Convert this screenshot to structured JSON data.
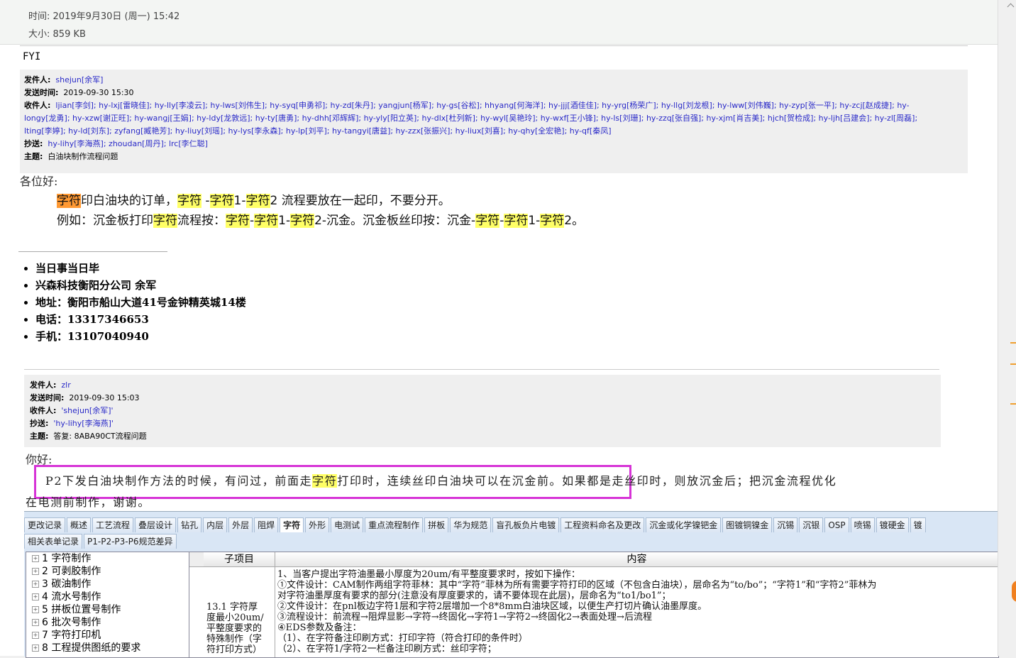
{
  "header": {
    "time_label": "时间:",
    "time_value": "2019年9月30日 (周一) 15:42",
    "size_label": "大小:",
    "size_value": "859 KB"
  },
  "fyi": "FYI",
  "quote1": {
    "from_label": "发件人:",
    "from": "shejun[余军]",
    "sent_label": "发送时间:",
    "sent": "2019-09-30 15:30",
    "to_label": "收件人:",
    "to_line1": "ljian[李剑]; hy-lxj[雷晓佳]; hy-lly[李凌云]; hy-lws[刘伟生]; hy-syq[申勇祁]; hy-zd[朱丹]; yangjun[杨军]; hy-gs[谷松]; hhyang[何海洋]; hy-jjj[酒佳佳]; hy-yrg[杨荣广]; hy-llg[刘龙根]; hy-lww[刘伟巍]; hy-zyp[张一平]; hy-zcj[赵成捷]; hy-",
    "to_line2": "longy[龙勇]; hy-xzw[谢正旺]; hy-wangj[王娟]; hy-ldy[龙敦远]; hy-ty[唐勇]; hy-dhh[邓辉辉]; hy-yly[阳立英]; hy-dlx[杜列新]; hy-wyl[吴艳玲]; hy-wxf[王小锋]; hy-ls[刘珊]; hy-zzq[张自强]; hy-xjm[肖吉美]; hjch[贺检成]; hy-ljh[吕建会]; hy-zl[周磊];",
    "to_line3": "lting[李婷]; hy-ld[刘东]; zyfang[臧艳芳]; hy-liuy[刘瑶]; hy-lys[李永森]; hy-lp[刘平]; hy-tangyi[唐益]; hy-zzx[张振兴]; hy-liux[刘喜]; hy-qhy[全宏艳]; hy-qf[秦凤]",
    "cc_label": "抄送:",
    "cc": "hy-lihy[李海燕]; zhoudan[周丹]; lrc[李仁聪]",
    "subject_label": "主题:",
    "subject": "白油块制作流程问题"
  },
  "greeting1": "各位好:",
  "body1": {
    "line1": [
      "字符",
      "印白油块的订单，",
      "字符",
      " -",
      "字符",
      "1-",
      "字符",
      "2 流程要放在一起印，不要分开。"
    ],
    "line2": [
      "例如：沉金板打印",
      "字符",
      "流程按：",
      "字符",
      "-",
      "字符",
      "1-",
      "字符",
      "2-沉金。沉金板丝印按：沉金-",
      "字符",
      "-",
      "字符",
      "1-",
      "字符",
      "2。"
    ]
  },
  "signature": [
    "当日事当日毕",
    "兴森科技衡阳分公司  余军",
    "地址：衡阳市船山大道41号金钟精英城14楼",
    "电话：13317346653",
    "手机：13107040940"
  ],
  "quote2": {
    "from_label": "发件人:",
    "from": "zlr",
    "sent_label": "发送时间:",
    "sent": "2019-09-30 15:03",
    "to_label": "收件人:",
    "to": "'shejun[余军]'",
    "cc_label": "抄送:",
    "cc": "'hy-lihy[李海燕]'",
    "subject_label": "主题:",
    "subject": "答复: 8ABA90CT流程问题"
  },
  "greeting2": "你好:",
  "msg2": {
    "part1": "P2下发白油块制作方法的时候，有问过，前面走",
    "hl": "字符",
    "part2": "打印时，连续丝印白油块可以在沉金前。如果都是走丝印时，则放沉金后；把沉金流程优化",
    "line2": "在电测前制作，谢谢。"
  },
  "app": {
    "tabs": [
      "更改记录",
      "概述",
      "工艺流程",
      "叠层设计",
      "钻孔",
      "内层",
      "外层",
      "阻焊",
      "字符",
      "外形",
      "电测试",
      "重点流程制作",
      "拼板",
      "华为规范",
      "盲孔板负片电镀",
      "工程资料命名及更改",
      "沉金或化学镍钯金",
      "图镀铜镍金",
      "沉锡",
      "沉银",
      "OSP",
      "喷锡",
      "镀硬金",
      "镀"
    ],
    "active_tab": "字符",
    "tabs2": [
      "相关表单记录",
      "P1-P2-P3-P6规范差异"
    ],
    "tree": [
      "1  字符制作",
      "2  可剥胶制作",
      "3  碳油制作",
      "4  流水号制作",
      "5  拼板位置号制作",
      "6  批次号制作",
      "7  字符打印机",
      "8  工程提供图纸的要求"
    ],
    "grid_headers": [
      "子项目",
      "内容"
    ],
    "sub_item": [
      "13.1 字符厚",
      "度最小20um/",
      "平整度要求的",
      "特殊制作（字",
      "符打印方式）"
    ],
    "content": [
      "1、当客户提出字符油墨最小厚度为20um/有平整度要求时，按如下操作：",
      "①文件设计：CAM制作两组字符菲林：其中“字符”菲林为所有需要字符打印的区域（不包含白油块），层命名为“to/bo”；“字符1”和“字符2”菲林为",
      "对字符油墨厚度有要求的部分(注意没有厚度要求的，请不要体现在此层)，层命名为“to1/bo1”；",
      "②文件设计：在pnl板边字符1层和字符2层增加一个8*8mm白油块区域，以便生产打切片确认油墨厚度。",
      "③流程设计：前流程→阻焊显影→字符→终固化→字符1→字符2→终固化2→表面处理→后流程",
      "④EDS参数及备注：",
      "（1）、在字符备注印刷方式：打印字符（符合打印的条件时）",
      "（2）、在字符1/字符2一栏备注印刷方式：丝印字符；"
    ]
  }
}
